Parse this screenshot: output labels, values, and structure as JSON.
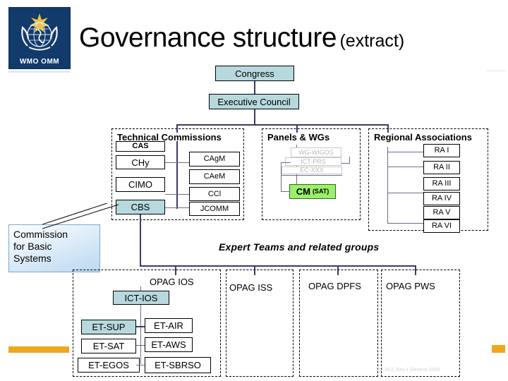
{
  "logo": {
    "text": "WMO OMM",
    "bg_color": "#123a6b",
    "icon": "wmo-globe-laurel-emblem"
  },
  "title": {
    "main": "Governance structure",
    "extract": "(extract)"
  },
  "top": {
    "congress": "Congress",
    "executive_council": "Executive Council",
    "box_color": "#b7d9de"
  },
  "panels": {
    "technical_commissions": {
      "title": "Technical Commissions",
      "left_items": [
        {
          "label": "CAS",
          "highlight": false
        },
        {
          "label": "CHy",
          "highlight": false
        },
        {
          "label": "CIMO",
          "highlight": false
        },
        {
          "label": "CBS",
          "highlight": true
        }
      ],
      "right_items": [
        {
          "label": "CAgM"
        },
        {
          "label": "CAeM"
        },
        {
          "label": "CCl"
        },
        {
          "label": "JCOMM"
        }
      ]
    },
    "panels_wgs": {
      "title": "Panels & WGs",
      "faded_items": [
        "WG-WIGOS",
        "ICT-PRS",
        "EC-XXX"
      ],
      "green_item": {
        "label": "CM",
        "suffix": "(SAT)",
        "color": "#9bf06a"
      }
    },
    "regional_associations": {
      "title": "Regional Associations",
      "items": [
        "RA I",
        "RA II",
        "RA III",
        "RA IV",
        "RA V",
        "RA VI"
      ]
    }
  },
  "callout": {
    "lines": [
      "Commission",
      "for Basic",
      "Systems"
    ]
  },
  "expert_section": {
    "label": "Expert Teams and related groups",
    "opags": [
      "OPAG IOS",
      "OPAG ISS",
      "OPAG DPFS",
      "OPAG PWS"
    ],
    "ict": {
      "label": "ICT-IOS",
      "highlight": true
    },
    "expert_teams": [
      {
        "label": "ET-SUP",
        "highlight": true
      },
      {
        "label": "ET-AIR",
        "highlight": false
      },
      {
        "label": "ET-SAT",
        "highlight": false
      },
      {
        "label": "ET-AWS",
        "highlight": false
      },
      {
        "label": "ET-EGOS",
        "highlight": false
      },
      {
        "label": "ET-SBRSO",
        "highlight": false
      }
    ]
  },
  "footer": {
    "note": "EC-XI/2, Rev.1 Geneva 2009",
    "accent_color": "#efa71c"
  }
}
